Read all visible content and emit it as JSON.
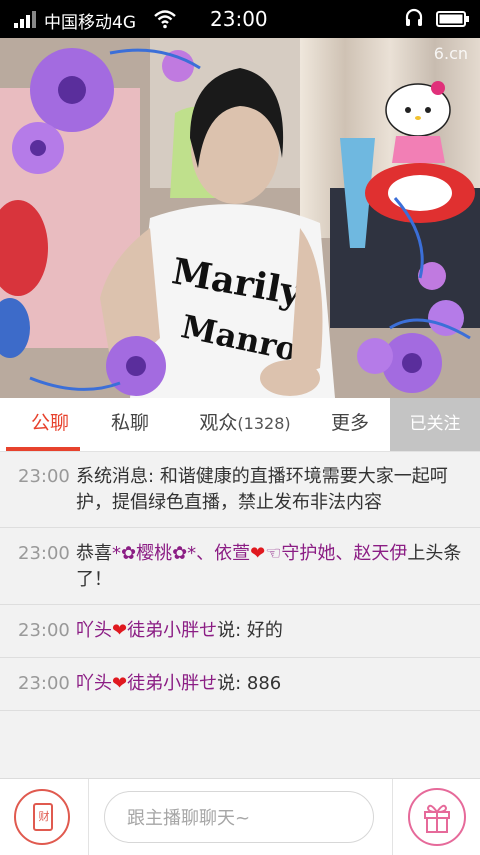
{
  "status_bar": {
    "carrier": "中国移动4G",
    "time": "23:00"
  },
  "video": {
    "watermark": "6.cn"
  },
  "tabs": [
    {
      "label": "公聊"
    },
    {
      "label": "私聊"
    },
    {
      "label": "观众",
      "count": "(1328)"
    },
    {
      "label": "更多"
    }
  ],
  "follow_button": "已关注",
  "messages": [
    {
      "time": "23:00",
      "prefix": "系统消息:",
      "text": "和谐健康的直播环境需要大家一起呵护，提倡绿色直播，禁止发布非法内容"
    },
    {
      "time": "23:00",
      "lead": "恭喜",
      "names": "*✿樱桃✿*、依萱",
      "heart": "❤",
      "names2": "☜守护她、赵天伊",
      "tail": "上头条了！"
    },
    {
      "time": "23:00",
      "user1": "吖头",
      "heart": "❤",
      "user2": "徒弟小胖せ",
      "says": "说:",
      "content": "好的"
    },
    {
      "time": "23:00",
      "user1": "吖头",
      "heart": "❤",
      "user2": "徒弟小胖せ",
      "says": "说:",
      "content": "886"
    }
  ],
  "bottom_bar": {
    "red_packet_char": "财",
    "chat_placeholder": "跟主播聊聊天~"
  }
}
